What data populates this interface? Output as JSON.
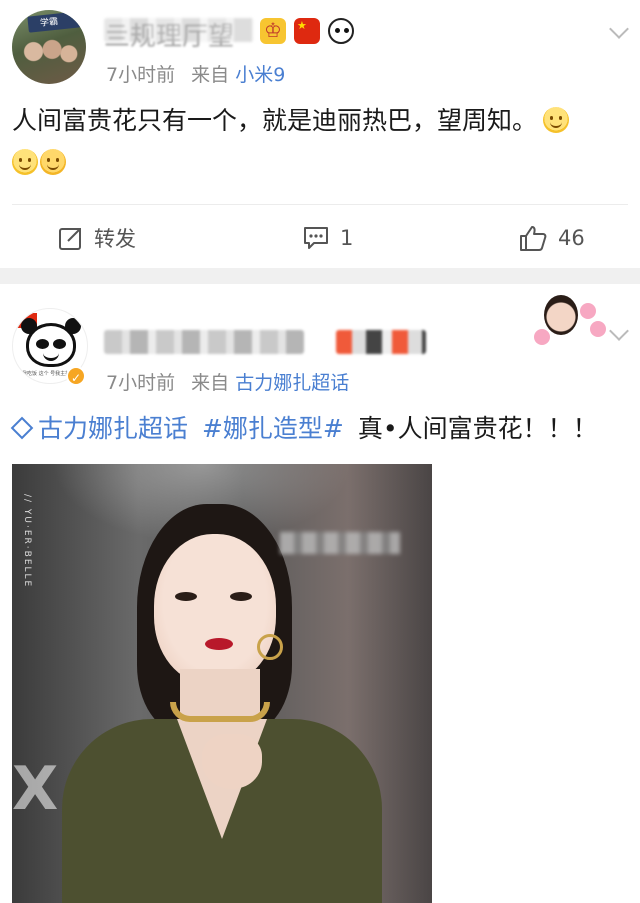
{
  "colors": {
    "link": "#4a7fd1",
    "meta": "#8a8a8a",
    "separator": "#f0f0f0",
    "lips": "#b8182a"
  },
  "post1": {
    "avatar_badge_text": "学霸",
    "username_visible_fragment": "亖规理厅望",
    "time": "7小时前",
    "source_prefix": "来自",
    "source": "小米9",
    "content": "人间富贵花只有一个，就是迪丽热巴，望周知。",
    "actions": {
      "repost": "转发",
      "comment": "1",
      "like": "46"
    },
    "icons": [
      "crown-badge",
      "china-flag-badge",
      "panda-badge"
    ]
  },
  "post2": {
    "avatar_caption": "看我吃饭 这个 号我主持公道",
    "time": "7小时前",
    "source_prefix": "来自",
    "source": "古力娜扎超话",
    "super_topic": "古力娜扎超话",
    "hashtag": "#娜扎造型#",
    "content": "真•人间富贵花！！！",
    "photo_vertical_text": "// YU·ER·BELLE"
  }
}
